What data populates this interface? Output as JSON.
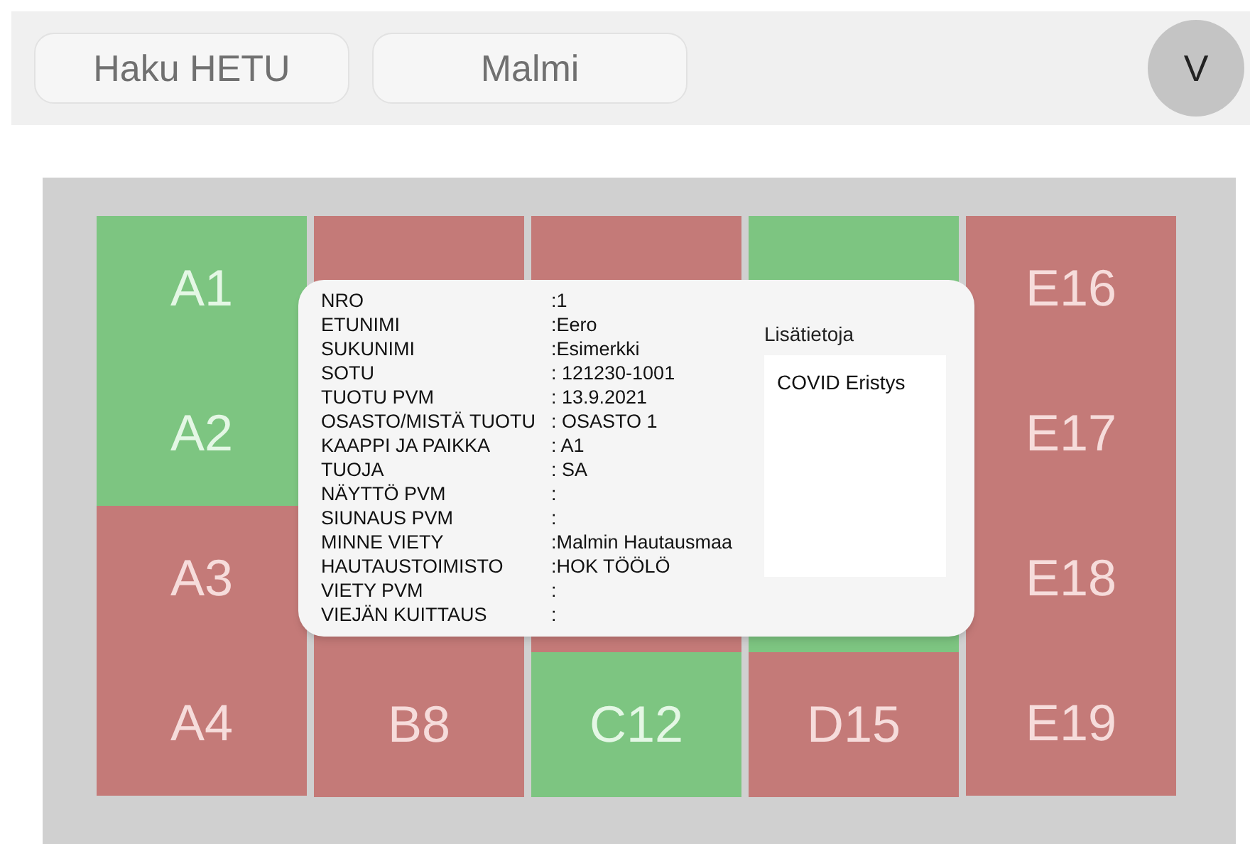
{
  "toolbar": {
    "buttons": [
      {
        "label": "Haku HETU"
      },
      {
        "label": "Malmi"
      }
    ],
    "avatar": "V"
  },
  "columns": [
    {
      "cells": [
        {
          "label": "A1",
          "occupied": false
        },
        {
          "label": "A2",
          "occupied": false
        },
        {
          "label": "A3",
          "occupied": true
        },
        {
          "label": "A4",
          "occupied": true
        }
      ]
    },
    {
      "cells": [
        {
          "occupied": true
        },
        {
          "label": "B8",
          "occupied": true
        }
      ]
    },
    {
      "cells": [
        {
          "occupied": true
        },
        {
          "label": "C12",
          "occupied": false
        }
      ]
    },
    {
      "cells": [
        {
          "occupied": false
        },
        {
          "label": "D15",
          "occupied": true
        }
      ]
    },
    {
      "cells": [
        {
          "label": "E16",
          "occupied": true
        },
        {
          "label": "E17",
          "occupied": true
        },
        {
          "label": "E18",
          "occupied": true
        },
        {
          "label": "E19",
          "occupied": true
        }
      ]
    }
  ],
  "popup": {
    "fields": [
      {
        "label": "NRO",
        "value": ":1"
      },
      {
        "label": "ETUNIMI",
        "value": ":Eero"
      },
      {
        "label": "SUKUNIMI",
        "value": ":Esimerkki"
      },
      {
        "label": "SOTU",
        "value": ": 121230-1001"
      },
      {
        "label": "TUOTU PVM",
        "value": ": 13.9.2021"
      },
      {
        "label": "OSASTO/MISTÄ TUOTU",
        "value": ": OSASTO 1"
      },
      {
        "label": "KAAPPI JA PAIKKA",
        "value": ": A1"
      },
      {
        "label": "TUOJA",
        "value": ": SA"
      },
      {
        "label": "NÄYTTÖ PVM",
        "value": ":"
      },
      {
        "label": "SIUNAUS PVM",
        "value": ":"
      },
      {
        "label": "MINNE VIETY",
        "value": ":Malmin Hautausmaa"
      },
      {
        "label": "HAUTAUSTOIMISTO",
        "value": ":HOK TÖÖLÖ"
      },
      {
        "label": "VIETY PVM",
        "value": ":"
      },
      {
        "label": "VIEJÄN KUITTAUS",
        "value": ":"
      }
    ],
    "notes_label": "Lisätietoja",
    "notes": "COVID Eristys"
  }
}
